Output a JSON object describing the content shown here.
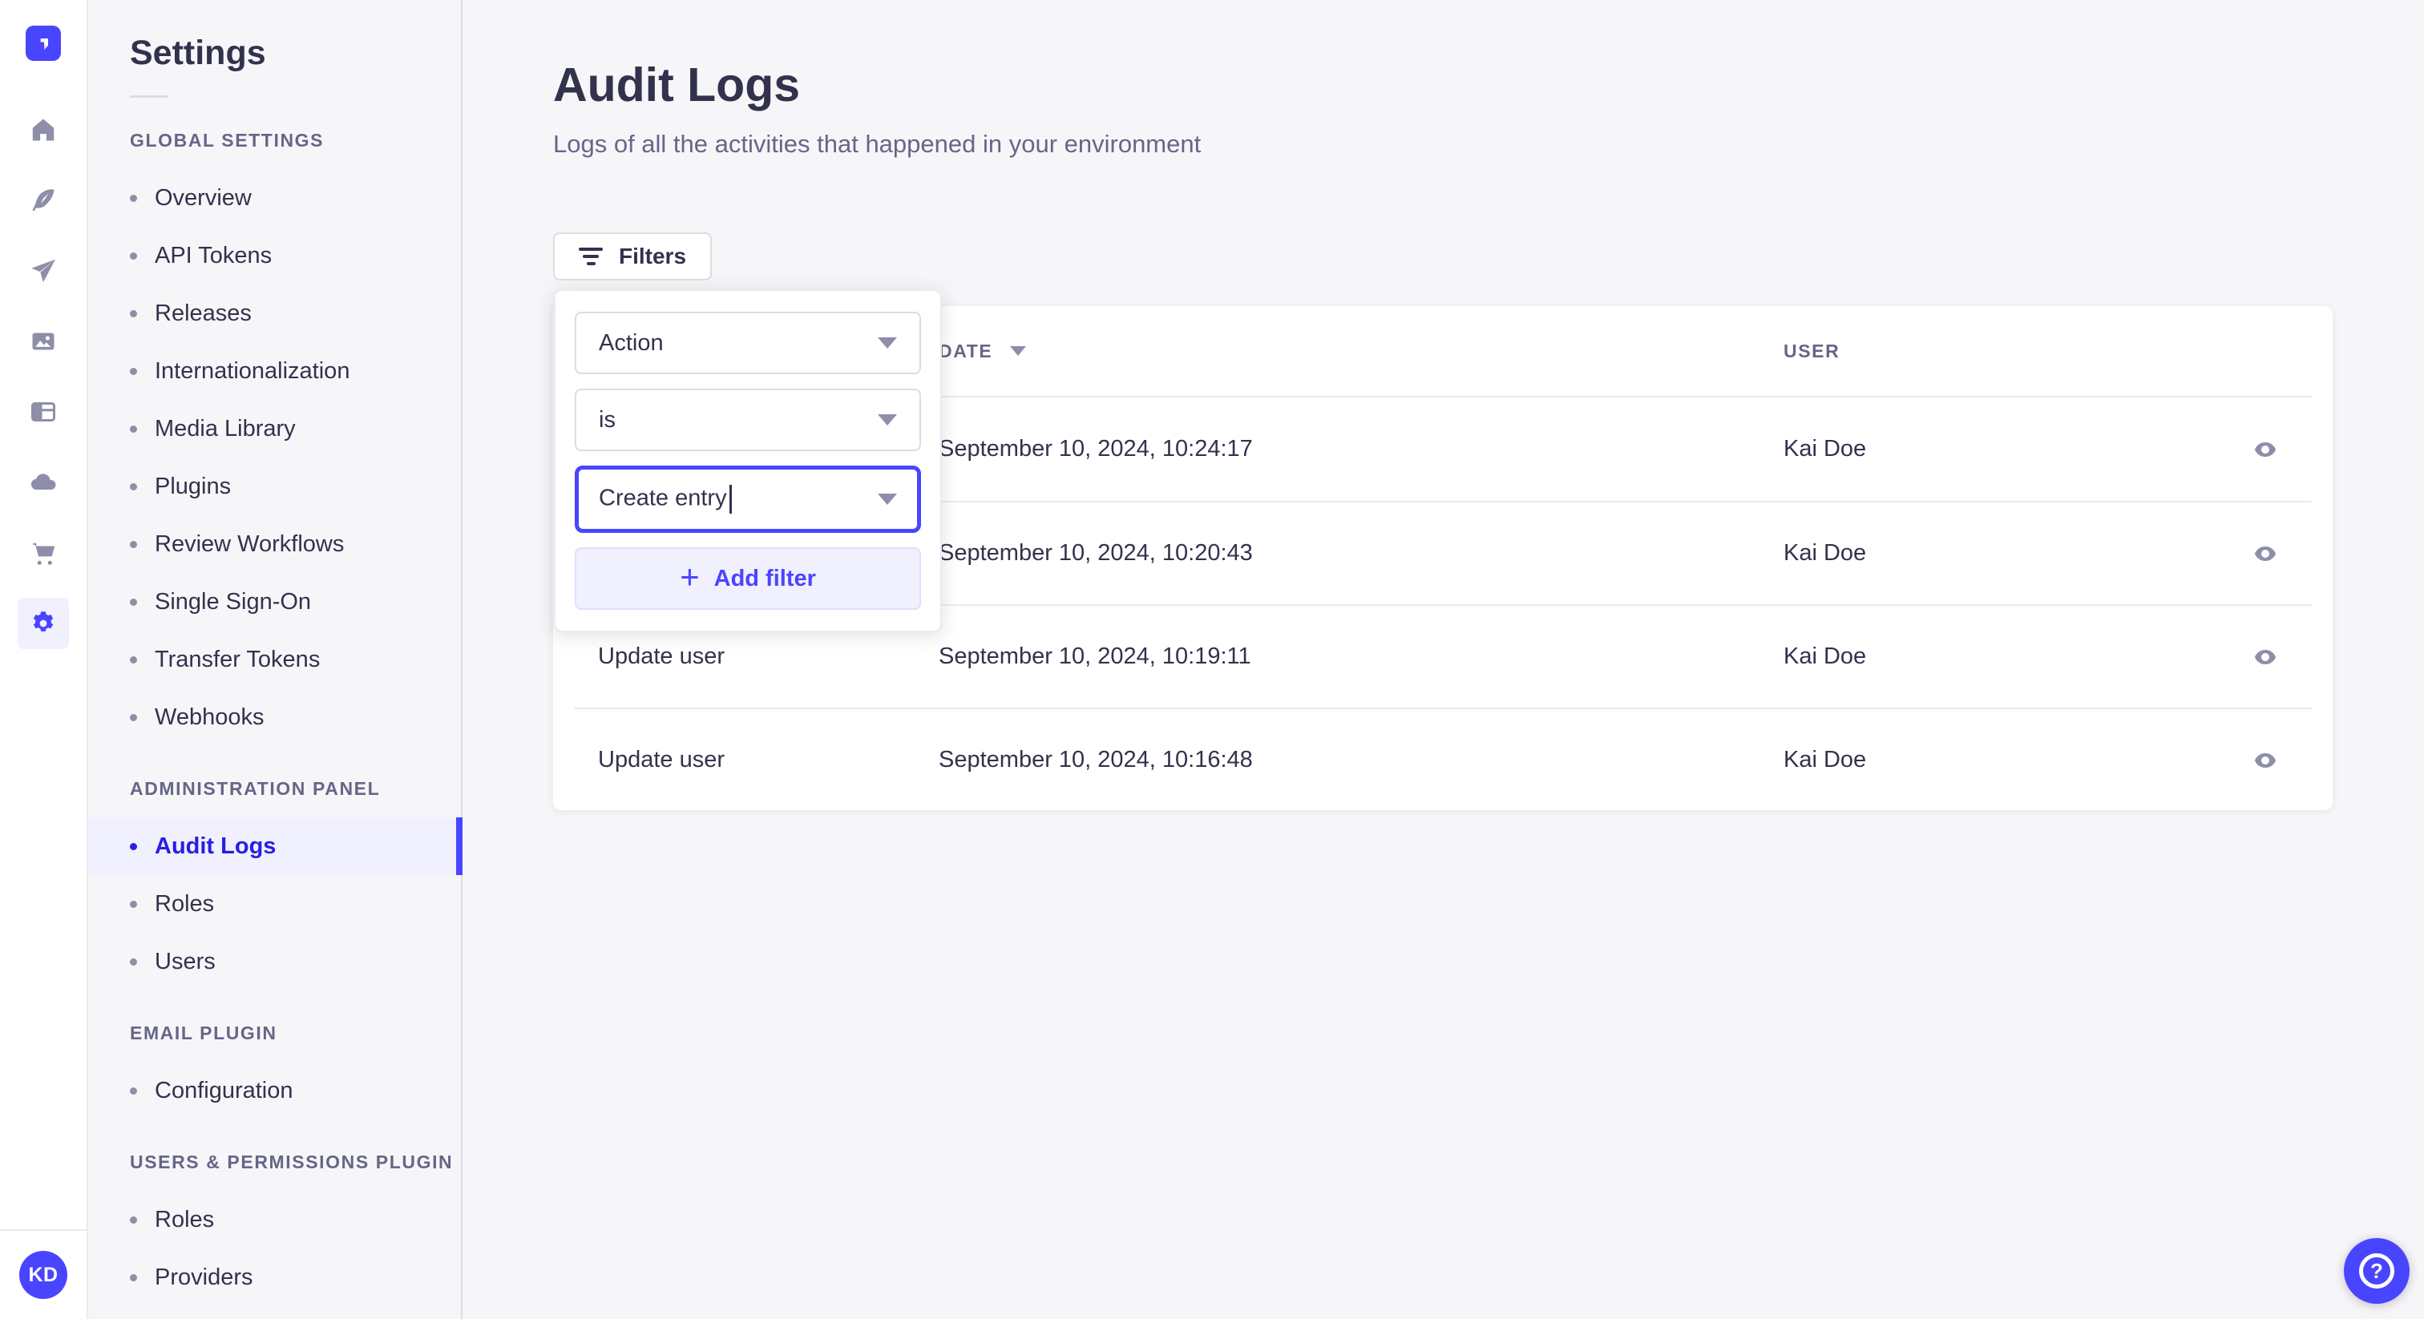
{
  "colors": {
    "primary": "#4945FF",
    "primary_dark": "#271FE0",
    "primary_bg": "#F0F0FF",
    "surface": "#FFFFFF",
    "app_bg": "#F6F6F9",
    "border": "#DCDCE4",
    "border_light": "#EAEAEF",
    "text": "#32324D",
    "text_muted": "#666687",
    "icon_gray": "#8E8EA9"
  },
  "rail": {
    "logo_icon": "strapi-logo",
    "nav_icons": [
      "home",
      "feather",
      "paper-plane",
      "media-library",
      "layout-panel",
      "cloud",
      "shopping-cart",
      "settings-gear"
    ],
    "active_icon": "settings-gear",
    "avatar_initials": "KD"
  },
  "sidebar": {
    "title": "Settings",
    "sections": [
      {
        "label": "GLOBAL SETTINGS",
        "items": [
          {
            "label": "Overview"
          },
          {
            "label": "API Tokens"
          },
          {
            "label": "Releases"
          },
          {
            "label": "Internationalization"
          },
          {
            "label": "Media Library"
          },
          {
            "label": "Plugins"
          },
          {
            "label": "Review Workflows"
          },
          {
            "label": "Single Sign-On"
          },
          {
            "label": "Transfer Tokens"
          },
          {
            "label": "Webhooks"
          }
        ]
      },
      {
        "label": "ADMINISTRATION PANEL",
        "items": [
          {
            "label": "Audit Logs",
            "active": true
          },
          {
            "label": "Roles"
          },
          {
            "label": "Users"
          }
        ]
      },
      {
        "label": "EMAIL PLUGIN",
        "items": [
          {
            "label": "Configuration"
          }
        ]
      },
      {
        "label": "USERS & PERMISSIONS PLUGIN",
        "items": [
          {
            "label": "Roles"
          },
          {
            "label": "Providers"
          }
        ]
      }
    ]
  },
  "main": {
    "title": "Audit Logs",
    "subtitle": "Logs of all the activities that happened in your environment"
  },
  "toolbar": {
    "filters_label": "Filters",
    "filters_icon": "filter-lines"
  },
  "filter_popover": {
    "field": {
      "value": "Action",
      "icon": "chevron-down"
    },
    "operator": {
      "value": "is",
      "icon": "chevron-down"
    },
    "value": {
      "value": "Create entry",
      "icon": "chevron-down",
      "focused": true
    },
    "add_filter": {
      "label": "Add filter",
      "icon": "plus",
      "plus_glyph": "+"
    }
  },
  "table": {
    "headers": {
      "action": "",
      "date": "DATE",
      "user": "USER"
    },
    "sort": {
      "column": "date",
      "icon": "caret-down"
    },
    "row_action_icon": "eye",
    "rows": [
      {
        "action": "",
        "date": "September 10, 2024, 10:24:17",
        "user": "Kai Doe"
      },
      {
        "action": "",
        "date": "September 10, 2024, 10:20:43",
        "user": "Kai Doe"
      },
      {
        "action": "Update user",
        "date": "September 10, 2024, 10:19:11",
        "user": "Kai Doe"
      },
      {
        "action": "Update user",
        "date": "September 10, 2024, 10:16:48",
        "user": "Kai Doe"
      }
    ]
  },
  "help": {
    "icon": "question-mark",
    "glyph": "?"
  }
}
